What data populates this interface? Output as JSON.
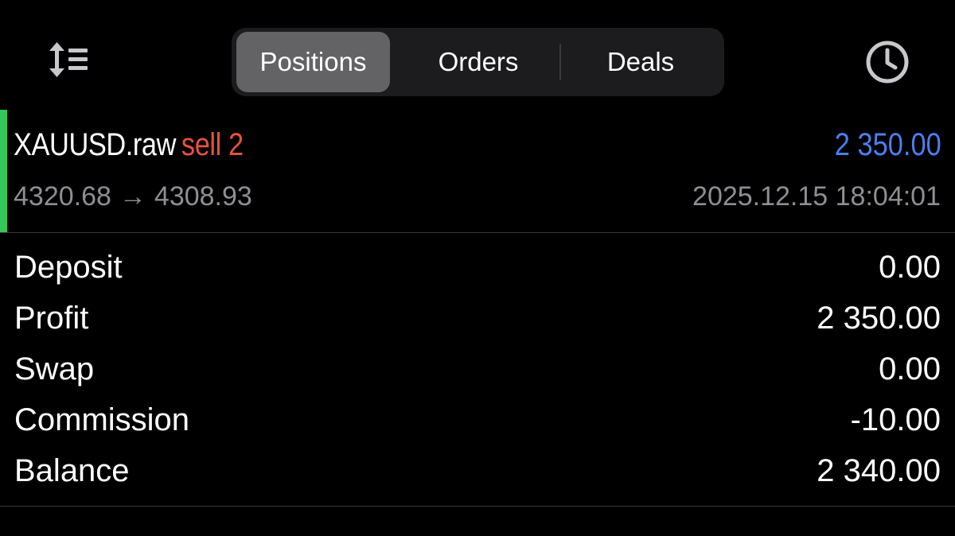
{
  "toolbar": {
    "sort_icon": "sort-icon",
    "history_icon": "clock-icon",
    "tabs": [
      {
        "label": "Positions",
        "active": true
      },
      {
        "label": "Orders",
        "active": false
      },
      {
        "label": "Deals",
        "active": false
      }
    ]
  },
  "deal": {
    "symbol": "XAUUSD.raw",
    "type": "sell 2",
    "profit": "2 350.00",
    "open_price": "4320.68",
    "arrow": "→",
    "close_price": "4308.93",
    "time": "2025.12.15 18:04:01"
  },
  "summary": [
    {
      "label": "Deposit",
      "value": "0.00"
    },
    {
      "label": "Profit",
      "value": "2 350.00"
    },
    {
      "label": "Swap",
      "value": "0.00"
    },
    {
      "label": "Commission",
      "value": "-10.00"
    },
    {
      "label": "Balance",
      "value": "2 340.00"
    }
  ],
  "colors": {
    "background": "#000000",
    "profit_blue": "#4a7ff0",
    "sell_red": "#e5533f",
    "marker_green": "#34c759",
    "secondary_gray": "#8e8e93"
  }
}
